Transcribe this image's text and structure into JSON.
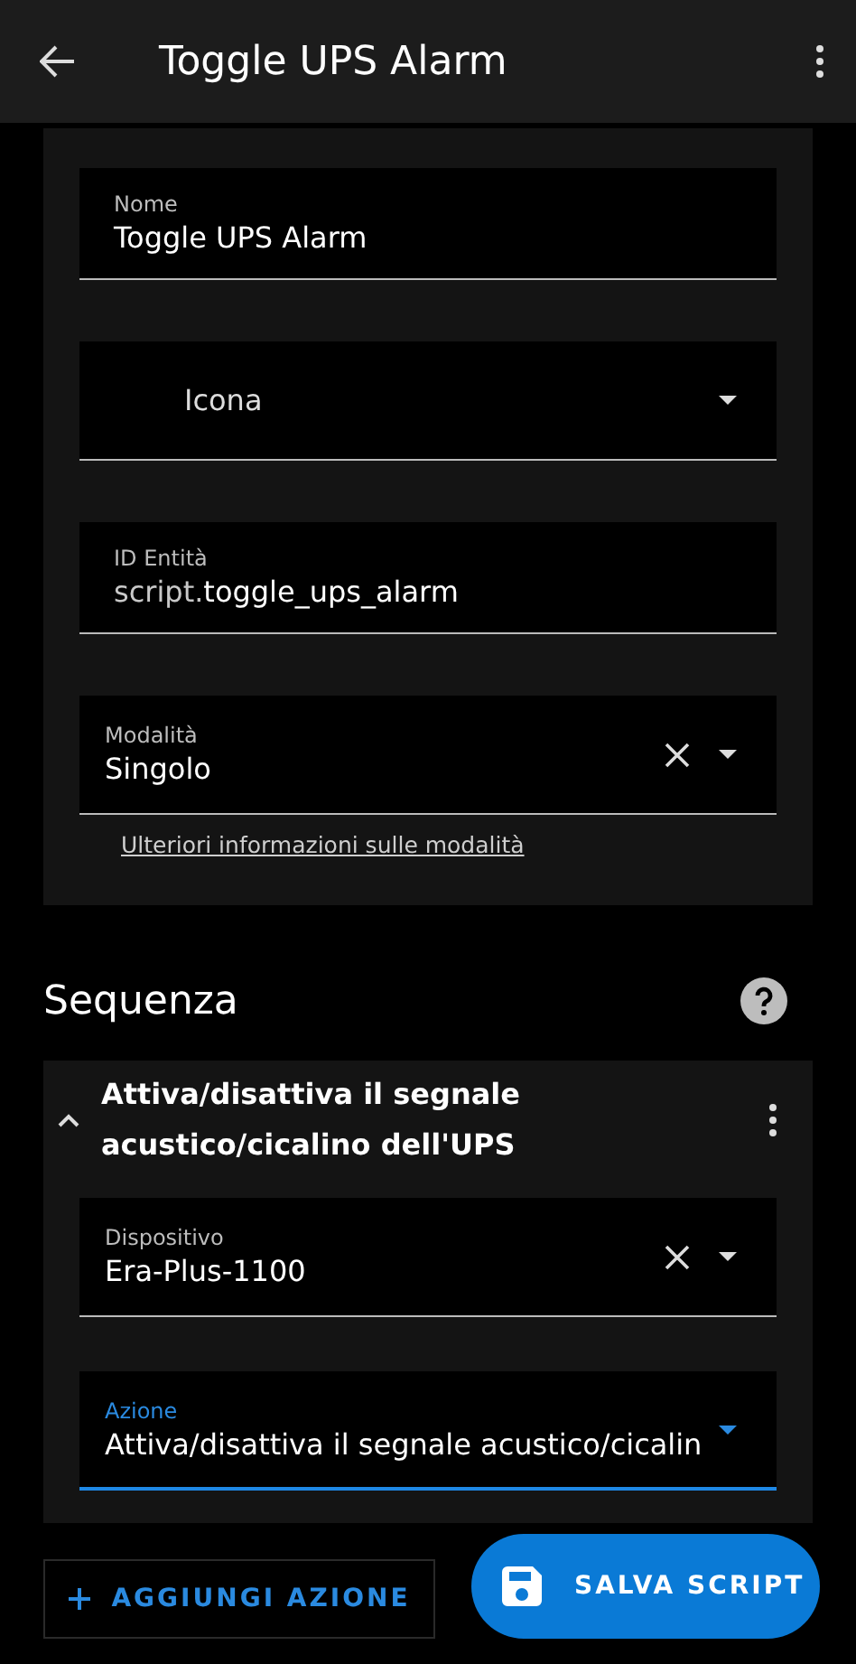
{
  "header": {
    "title": "Toggle UPS Alarm"
  },
  "settings_fields": [
    {
      "kind": "text",
      "label": "Nome",
      "value": "Toggle UPS Alarm",
      "clearable": false,
      "dropdown": false,
      "focused": false
    },
    {
      "kind": "icon-picker",
      "label": "Icona",
      "clearable": false,
      "dropdown": true,
      "focused": false
    },
    {
      "kind": "text",
      "label": "ID Entità",
      "prefix": "script.",
      "value": "toggle_ups_alarm",
      "clearable": false,
      "dropdown": false,
      "focused": false
    },
    {
      "kind": "select",
      "label": "Modalità",
      "value": "Singolo",
      "clearable": true,
      "dropdown": true,
      "focused": false
    }
  ],
  "mode_link": "Ulteriori informazioni sulle modalità",
  "sequence": {
    "title": "Sequenza",
    "action": {
      "title": "Attiva/disattiva il segnale acustico/cicalino dell'UPS",
      "expanded": true,
      "fields": [
        {
          "kind": "select",
          "label": "Dispositivo",
          "value": "Era-Plus-1100",
          "clearable": true,
          "dropdown": true,
          "focused": false
        },
        {
          "kind": "select",
          "label": "Azione",
          "value": "Attiva/disattiva il segnale acustico/cicalin",
          "clearable": false,
          "dropdown": true,
          "focused": true
        }
      ]
    }
  },
  "buttons": {
    "add": "AGGIUNGI AZIONE",
    "save": "SALVA SCRIPT"
  }
}
